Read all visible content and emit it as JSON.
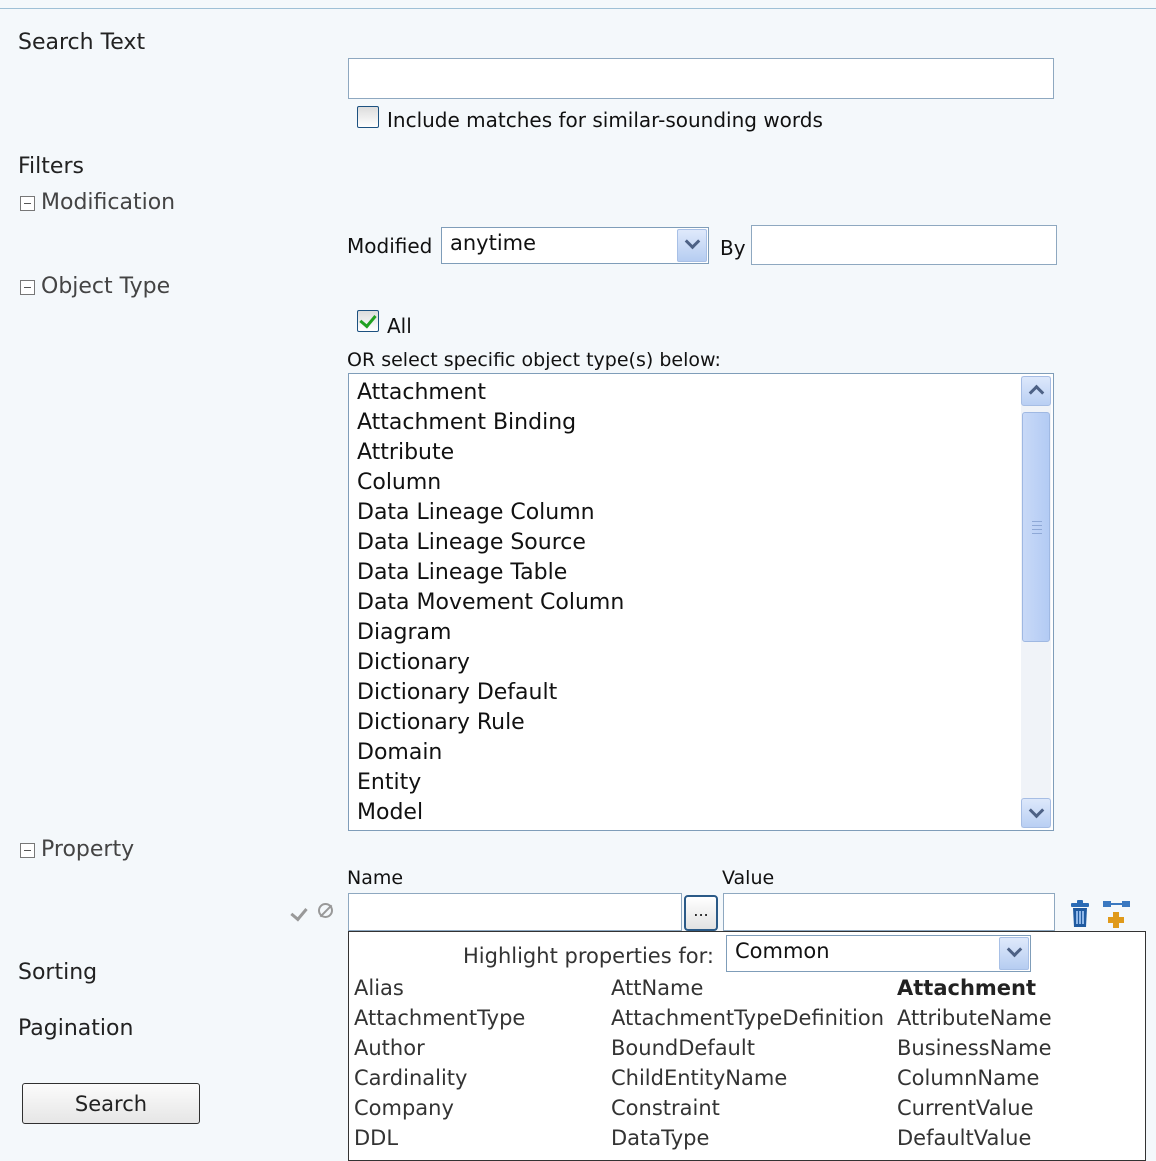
{
  "search": {
    "label": "Search Text",
    "value": "",
    "similar_label": "Include matches for similar-sounding words",
    "similar_checked": false
  },
  "filters": {
    "label": "Filters",
    "modification": {
      "label": "Modification",
      "modified_label": "Modified",
      "modified_value": "anytime",
      "by_label": "By",
      "by_value": ""
    },
    "object_type": {
      "label": "Object Type",
      "all_label": "All",
      "all_checked": true,
      "or_label": "OR select specific object type(s) below:",
      "items": [
        "Attachment",
        "Attachment Binding",
        "Attribute",
        "Column",
        "Data Lineage Column",
        "Data Lineage Source",
        "Data Lineage Table",
        "Data Movement Column",
        "Diagram",
        "Dictionary",
        "Dictionary Default",
        "Dictionary Rule",
        "Domain",
        "Entity",
        "Model"
      ]
    },
    "property": {
      "label": "Property",
      "name_label": "Name",
      "value_label": "Value",
      "name_value": "",
      "value_value": "",
      "browse_label": "...",
      "highlight_label": "Highlight properties for:",
      "highlight_value": "Common",
      "columns": [
        [
          "Alias",
          "AttachmentType",
          "Author",
          "Cardinality",
          "Company",
          "DDL"
        ],
        [
          "AttName",
          "AttachmentTypeDefinition",
          "BoundDefault",
          "ChildEntityName",
          "Constraint",
          "DataType"
        ],
        [
          "Attachment",
          "AttributeName",
          "BusinessName",
          "ColumnName",
          "CurrentValue",
          "DefaultValue"
        ]
      ],
      "bold_item": "Attachment"
    }
  },
  "sorting": {
    "label": "Sorting"
  },
  "pagination": {
    "label": "Pagination"
  },
  "search_button": {
    "label": "Search"
  },
  "icons": {
    "confirm": "check-icon",
    "cancel": "cancel-icon",
    "delete": "trash-icon",
    "add": "add-property-icon",
    "collapse": "minus-box-icon"
  }
}
